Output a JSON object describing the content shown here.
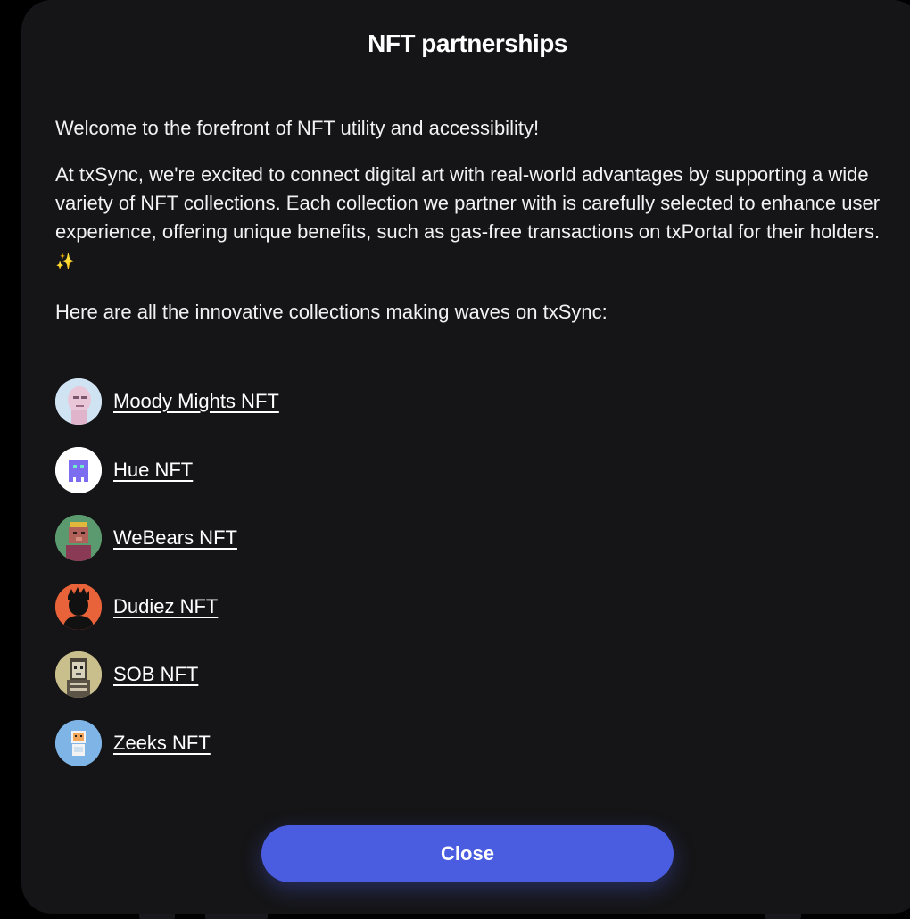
{
  "modal": {
    "title": "NFT partnerships",
    "paragraphs": {
      "welcome": "Welcome to the forefront of NFT utility and accessibility!",
      "body": "At txSync, we're excited to connect digital art with real-world advantages by supporting a wide variety of NFT collections. Each collection we partner with is carefully selected to enhance user experience, offering unique benefits, such as gas-free transactions on txPortal for their holders.",
      "sparkle": "✨",
      "lead_in": "Here are all the innovative collections making waves on txSync:"
    },
    "collections": [
      {
        "name": "Moody Mights NFT",
        "icon": "moody-mights-avatar",
        "color": "#cfe3f3"
      },
      {
        "name": "Hue NFT",
        "icon": "hue-avatar",
        "color": "#ffffff"
      },
      {
        "name": "WeBears NFT",
        "icon": "webears-avatar",
        "color": "#5a9a6e"
      },
      {
        "name": "Dudiez NFT",
        "icon": "dudiez-avatar",
        "color": "#e8633a"
      },
      {
        "name": "SOB NFT",
        "icon": "sob-avatar",
        "color": "#c9bf8c"
      },
      {
        "name": "Zeeks NFT",
        "icon": "zeeks-avatar",
        "color": "#7fb5e6"
      }
    ],
    "close_label": "Close",
    "colors": {
      "background": "#151517",
      "accent": "#4a5de0",
      "text": "#ffffff"
    }
  }
}
